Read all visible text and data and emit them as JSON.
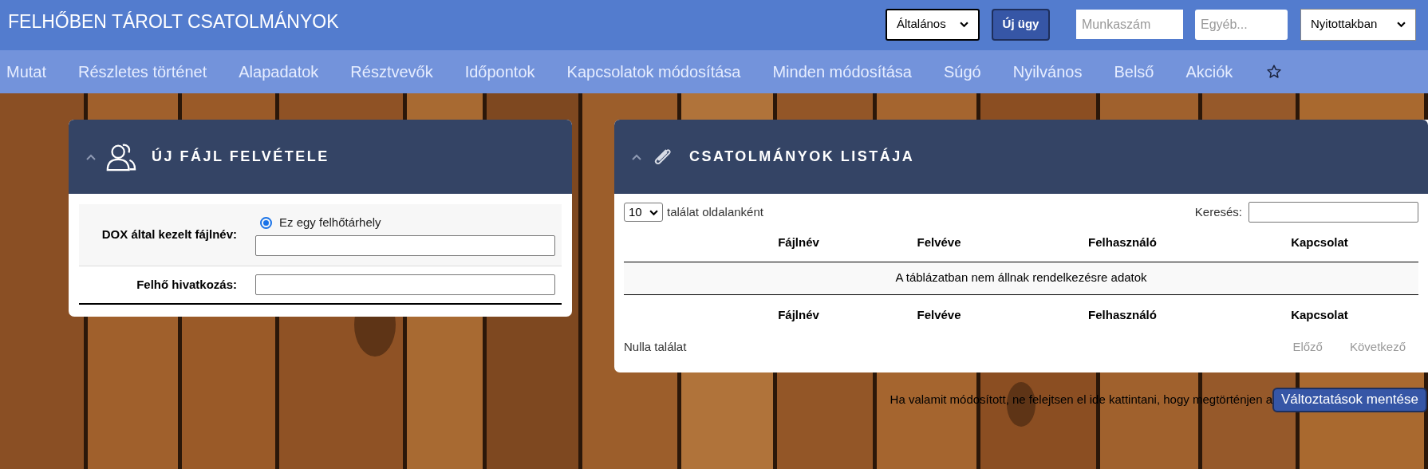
{
  "header": {
    "title": "FELHŐBEN TÁROLT CSATOLMÁNYOK",
    "category_select": {
      "value": "Általános"
    },
    "new_case_button": "Új ügy",
    "job_number_field": {
      "placeholder": "Munkaszám"
    },
    "other_field": {
      "placeholder": "Egyéb..."
    },
    "scope_select": {
      "value": "Nyitottakban"
    }
  },
  "nav": {
    "items": [
      "Mutat",
      "Részletes történet",
      "Alapadatok",
      "Résztvevők",
      "Időpontok",
      "Kapcsolatok módosítása",
      "Minden módosítása",
      "Súgó",
      "Nyilvános",
      "Belső",
      "Akciók"
    ]
  },
  "new_file_panel": {
    "title": "ÚJ FÁJL FELVÉTELE",
    "rows": [
      {
        "label": "DOX által kezelt fájlnév:",
        "radio": {
          "label": "Ez egy felhőtárhely",
          "checked": true
        }
      },
      {
        "label": "Felhő hivatkozás:"
      }
    ]
  },
  "attachments_panel": {
    "title": "CSATOLMÁNYOK LISTÁJA",
    "page_size": "10",
    "page_size_label": "találat oldalanként",
    "search_label": "Keresés:",
    "columns": [
      "Fájlnév",
      "Felvéve",
      "Felhasználó",
      "Kapcsolat"
    ],
    "empty_message": "A táblázatban nem állnak rendelkezésre adatok",
    "footer_columns": [
      "Fájlnév",
      "Felvéve",
      "Felhasználó",
      "Kapcsolat"
    ],
    "info": "Nulla találat",
    "pagination": [
      {
        "label": "Előző",
        "disabled": true
      },
      {
        "label": "Következő",
        "disabled": true
      }
    ]
  },
  "save_bar": {
    "hint": "Ha valamit módosított, ne felejtsen el ide kattintani, hogy megtörténjen a",
    "button": "Változtatások mentése"
  }
}
